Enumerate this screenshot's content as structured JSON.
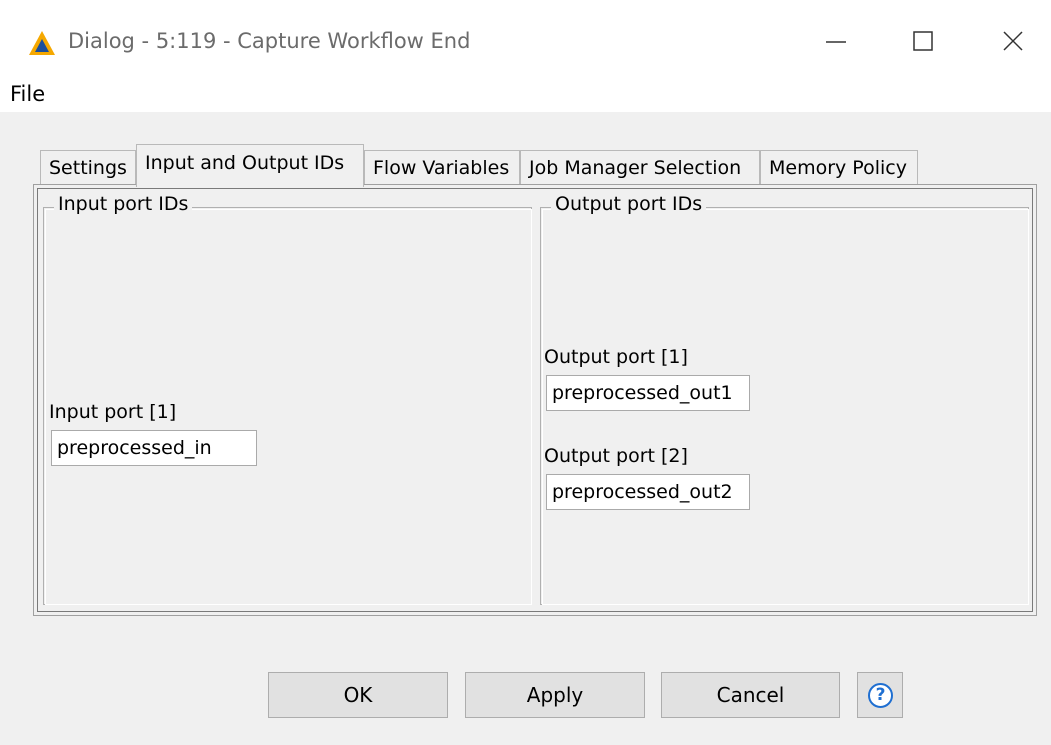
{
  "window": {
    "title": "Dialog - 5:119 - Capture Workflow End",
    "icon": "warning-triangle-icon",
    "controls": {
      "minimize": "minimize-icon",
      "maximize": "maximize-icon",
      "close": "close-icon"
    }
  },
  "menu": {
    "file_label": "File"
  },
  "tabs": [
    {
      "label": "Settings",
      "active": false
    },
    {
      "label": "Input and Output IDs",
      "active": true
    },
    {
      "label": "Flow Variables",
      "active": false
    },
    {
      "label": "Job Manager Selection",
      "active": false
    },
    {
      "label": "Memory Policy",
      "active": false
    }
  ],
  "input_group": {
    "title": "Input port IDs",
    "fields": [
      {
        "label": "Input port [1]",
        "value": "preprocessed_in"
      }
    ]
  },
  "output_group": {
    "title": "Output port IDs",
    "fields": [
      {
        "label": "Output port [1]",
        "value": "preprocessed_out1"
      },
      {
        "label": "Output port [2]",
        "value": "preprocessed_out2"
      }
    ]
  },
  "buttons": {
    "ok": "OK",
    "apply": "Apply",
    "cancel": "Cancel",
    "help_icon": "help-icon",
    "help_glyph": "?"
  },
  "colors": {
    "accent": "#1f6fd1",
    "warning_icon": "#f5a800"
  }
}
